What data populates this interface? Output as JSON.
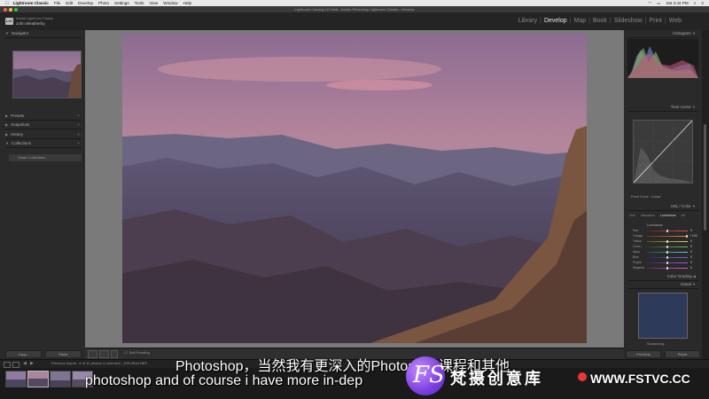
{
  "menubar": {
    "apple_icon": "apple-icon",
    "items": [
      "Lightroom Classic",
      "File",
      "Edit",
      "Develop",
      "Photo",
      "Settings",
      "Tools",
      "View",
      "Window",
      "Help"
    ],
    "clock": "Sat 4:44 PM"
  },
  "window": {
    "title": "Lightroom Catalog v10.lrcat - Adobe Photoshop Lightroom Classic - Develop"
  },
  "identity": {
    "badge": "LrC",
    "line1": "Adobe Lightroom Classic",
    "line2": "John Weatherby"
  },
  "modules": {
    "items": [
      "Library",
      "Develop",
      "Map",
      "Book",
      "Slideshow",
      "Print",
      "Web"
    ],
    "active": "Develop"
  },
  "left_panel": {
    "navigator": "Navigator",
    "presets": "Presets",
    "snapshots": "Snapshots",
    "history": "History",
    "collections": "Collections",
    "collection_item": "Smart Collections",
    "copy_button": "Copy...",
    "paste_button": "Paste"
  },
  "right_panel": {
    "histogram": "Histogram",
    "tone_curve": "Tone Curve",
    "point_curve": "Point Curve : Linear",
    "hsl": "HSL / Color",
    "hsl_tabs": [
      "Hue",
      "Saturation",
      "Luminance",
      "All"
    ],
    "luminance_label": "Luminance",
    "hsl_rows": [
      "Red",
      "Orange",
      "Yellow",
      "Green",
      "Aqua",
      "Blue",
      "Purple",
      "Magenta"
    ],
    "hsl_values": [
      "0",
      "+ 100",
      "0",
      "0",
      "0",
      "0",
      "0",
      "0"
    ],
    "color_grading": "Color Grading",
    "detail": "Detail",
    "sharpening": "Sharpening",
    "previous_button": "Previous",
    "reset_button": "Reset"
  },
  "toolbar": {
    "soft_proofing": "Soft Proofing"
  },
  "filmstrip": {
    "source": "Previous Import",
    "info": "6 of 10 photos /1 selected /_DSC9544.NEF"
  },
  "subtitles": {
    "chinese": "Photoshop，当然我有更深入的Photoshop课程和其他",
    "english": "photoshop and of course i have more in-dep"
  },
  "watermark": {
    "logo": "FS",
    "site_cn": "梵摄创意库",
    "url": "WWW.FSTVC.CC"
  }
}
